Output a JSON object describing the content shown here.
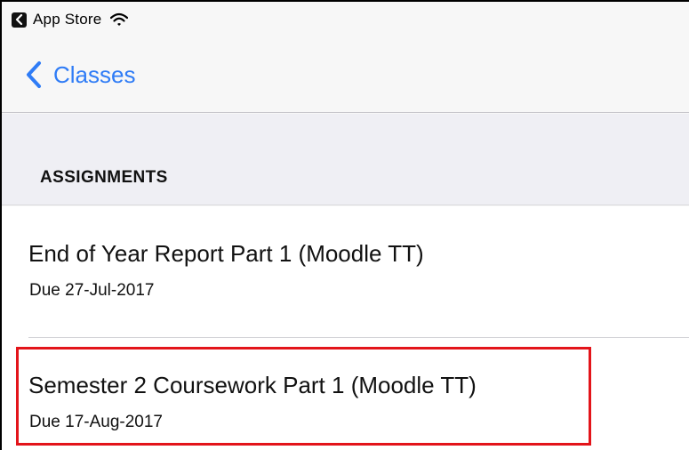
{
  "status_bar": {
    "back_app_label": "App Store",
    "icons": [
      "back-to-app-icon",
      "wifi-icon"
    ]
  },
  "nav": {
    "back_label": "Classes",
    "back_icon": "chevron-left-icon",
    "accent_color": "#2F7CF6"
  },
  "section": {
    "title": "ASSIGNMENTS"
  },
  "assignments": [
    {
      "title": "End of Year Report Part 1 (Moodle TT)",
      "due": "Due 27-Jul-2017"
    },
    {
      "title": "Semester 2 Coursework Part 1 (Moodle TT)",
      "due": "Due 17-Aug-2017"
    }
  ],
  "highlight": {
    "color": "#E3141A"
  }
}
